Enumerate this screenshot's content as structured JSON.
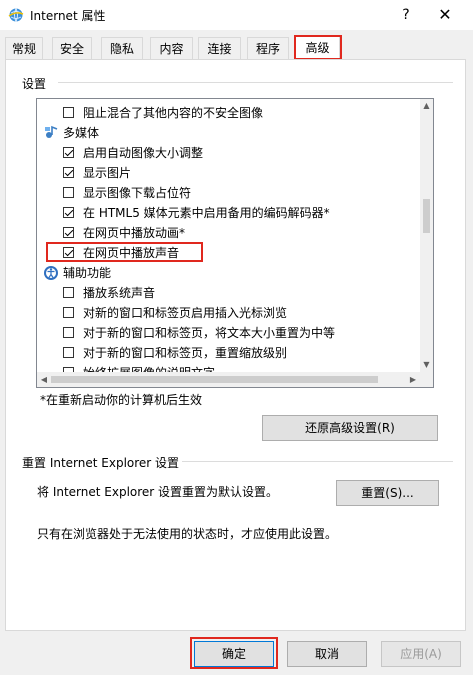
{
  "window": {
    "title": "Internet 属性",
    "help_glyph": "?",
    "close_glyph": "✕",
    "icon": "internet-globe-icon"
  },
  "tabs": [
    {
      "label": "常规",
      "active": false
    },
    {
      "label": "安全",
      "active": false
    },
    {
      "label": "隐私",
      "active": false
    },
    {
      "label": "内容",
      "active": false
    },
    {
      "label": "连接",
      "active": false
    },
    {
      "label": "程序",
      "active": false
    },
    {
      "label": "高级",
      "active": true
    }
  ],
  "settings": {
    "group_label": "设置",
    "rows": [
      {
        "kind": "checkbox",
        "label": "阻止混合了其他内容的不安全图像",
        "checked": false
      },
      {
        "kind": "category",
        "label": "多媒体",
        "icon": "multimedia-icon"
      },
      {
        "kind": "checkbox",
        "label": "启用自动图像大小调整",
        "checked": true
      },
      {
        "kind": "checkbox",
        "label": "显示图片",
        "checked": true
      },
      {
        "kind": "checkbox",
        "label": "显示图像下载占位符",
        "checked": false
      },
      {
        "kind": "checkbox",
        "label": "在 HTML5 媒体元素中启用备用的编码解码器*",
        "checked": true
      },
      {
        "kind": "checkbox",
        "label": "在网页中播放动画*",
        "checked": true
      },
      {
        "kind": "checkbox",
        "label": "在网页中播放声音",
        "checked": true
      },
      {
        "kind": "category",
        "label": "辅助功能",
        "icon": "accessibility-icon"
      },
      {
        "kind": "checkbox",
        "label": "播放系统声音",
        "checked": false
      },
      {
        "kind": "checkbox",
        "label": "对新的窗口和标签页启用插入光标浏览",
        "checked": false
      },
      {
        "kind": "checkbox",
        "label": "对于新的窗口和标签页，将文本大小重置为中等",
        "checked": false
      },
      {
        "kind": "checkbox",
        "label": "对于新的窗口和标签页，重置缩放级别",
        "checked": false
      },
      {
        "kind": "checkbox",
        "label": "始终扩展图像的说明文字",
        "checked": false
      }
    ],
    "restart_note": "*在重新启动你的计算机后生效",
    "restore_button": "还原高级设置(R)"
  },
  "reset": {
    "group_label": "重置 Internet Explorer 设置",
    "description": "将 Internet Explorer 设置重置为默认设置。",
    "reset_button": "重置(S)...",
    "hint": "只有在浏览器处于无法使用的状态时，才应使用此设置。"
  },
  "footer": {
    "ok": "确定",
    "cancel": "取消",
    "apply": "应用(A)"
  },
  "colors": {
    "highlight": "#e0281e",
    "accent": "#0078d7"
  }
}
